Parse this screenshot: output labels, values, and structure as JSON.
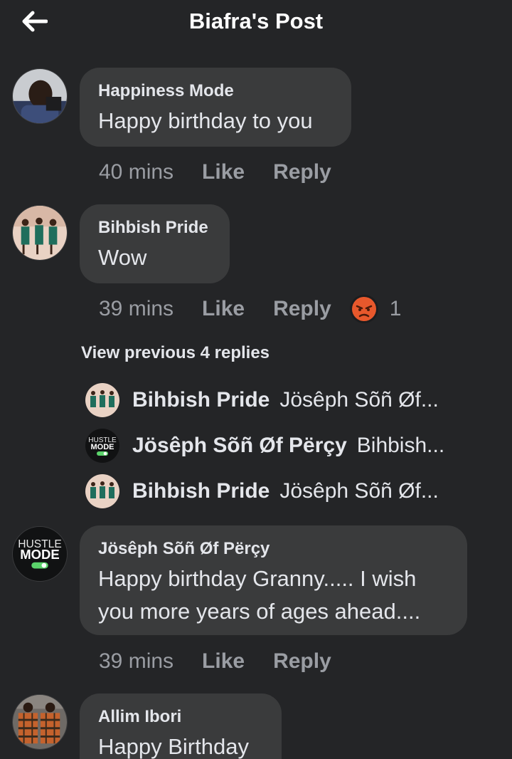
{
  "header": {
    "title": "Biafra's Post",
    "back_icon": "arrow-left-icon"
  },
  "comments": [
    {
      "author": "Happiness Mode",
      "text": "Happy birthday to you",
      "time": "40 mins",
      "like": "Like",
      "reply": "Reply"
    },
    {
      "author": "Bihbish Pride",
      "text": "Wow",
      "time": "39 mins",
      "like": "Like",
      "reply": "Reply",
      "reaction": {
        "icon": "angry-emoji-icon",
        "count": "1"
      }
    },
    {
      "author": "Jösêph Sõñ Øf Përçy",
      "text": "Happy birthday Granny..... I wish you more years of ages ahead....",
      "time": "39 mins",
      "like": "Like",
      "reply": "Reply"
    },
    {
      "author": "Allim Ibori",
      "text": "Happy Birthday"
    }
  ],
  "view_previous": "View previous 4 replies",
  "replies": [
    {
      "name": "Bihbish Pride",
      "snippet": "Jösêph Sõñ Øf..."
    },
    {
      "name": "Jösêph Sõñ Øf Përçy",
      "snippet": "Bihbish..."
    },
    {
      "name": "Bihbish Pride",
      "snippet": "Jösêph Sõñ Øf..."
    }
  ],
  "avatar_logo": {
    "line1": "HUSTLE",
    "line2": "MODE"
  },
  "colors": {
    "background": "#242527",
    "bubble": "#3a3b3c",
    "meta": "#9a9da3",
    "text": "#e4e6eb"
  }
}
